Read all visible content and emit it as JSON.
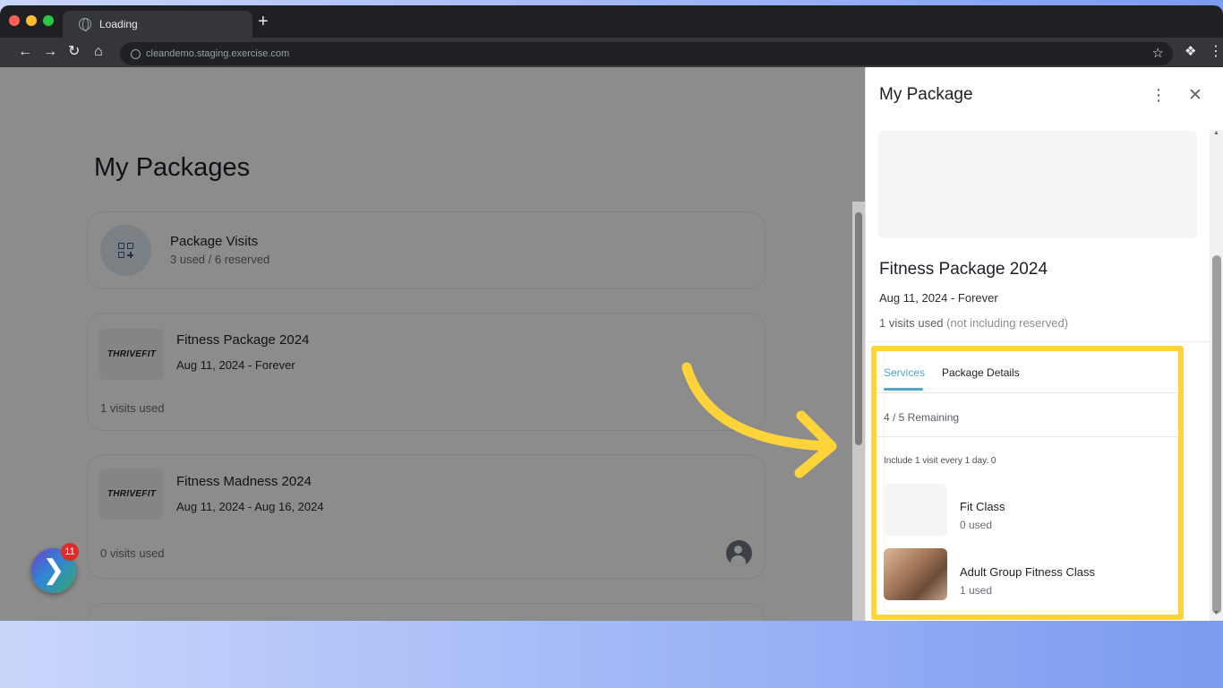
{
  "browser": {
    "tab_title": "Loading",
    "new_tab": "+",
    "url": "cleandemo.staging.exercise.com"
  },
  "page": {
    "title": "My Packages",
    "cards": {
      "visits": {
        "title": "Package Visits",
        "sub": "3 used / 6 reserved"
      },
      "fitness2024": {
        "logo": "THRIVEFIT",
        "title": "Fitness Package 2024",
        "dates": "Aug 11, 2024 - Forever",
        "used": "1 visits used"
      },
      "madness2024": {
        "logo": "THRIVEFIT",
        "title": "Fitness Madness 2024",
        "dates": "Aug 11, 2024 - Aug 16, 2024",
        "used": "0 visits used"
      }
    }
  },
  "launcher": {
    "badge": "11"
  },
  "panel": {
    "title": "My Package",
    "package_title": "Fitness Package 2024",
    "dates": "Aug 11, 2024 - Forever",
    "visits_used": "1 visits used",
    "visits_note": "(not including reserved)",
    "tabs": {
      "services": "Services",
      "details": "Package Details"
    },
    "remaining": "4 / 5 Remaining",
    "include_text": "Include 1 visit every 1 day. 0",
    "services": [
      {
        "title": "Fit Class",
        "used": "0 used"
      },
      {
        "title": "Adult Group Fitness Class",
        "used": "1 used"
      }
    ]
  },
  "colors": {
    "accent": "#4aa8c8",
    "highlight": "#ffd43b",
    "arrow": "#ffd43b",
    "badge": "#e02b2b"
  }
}
